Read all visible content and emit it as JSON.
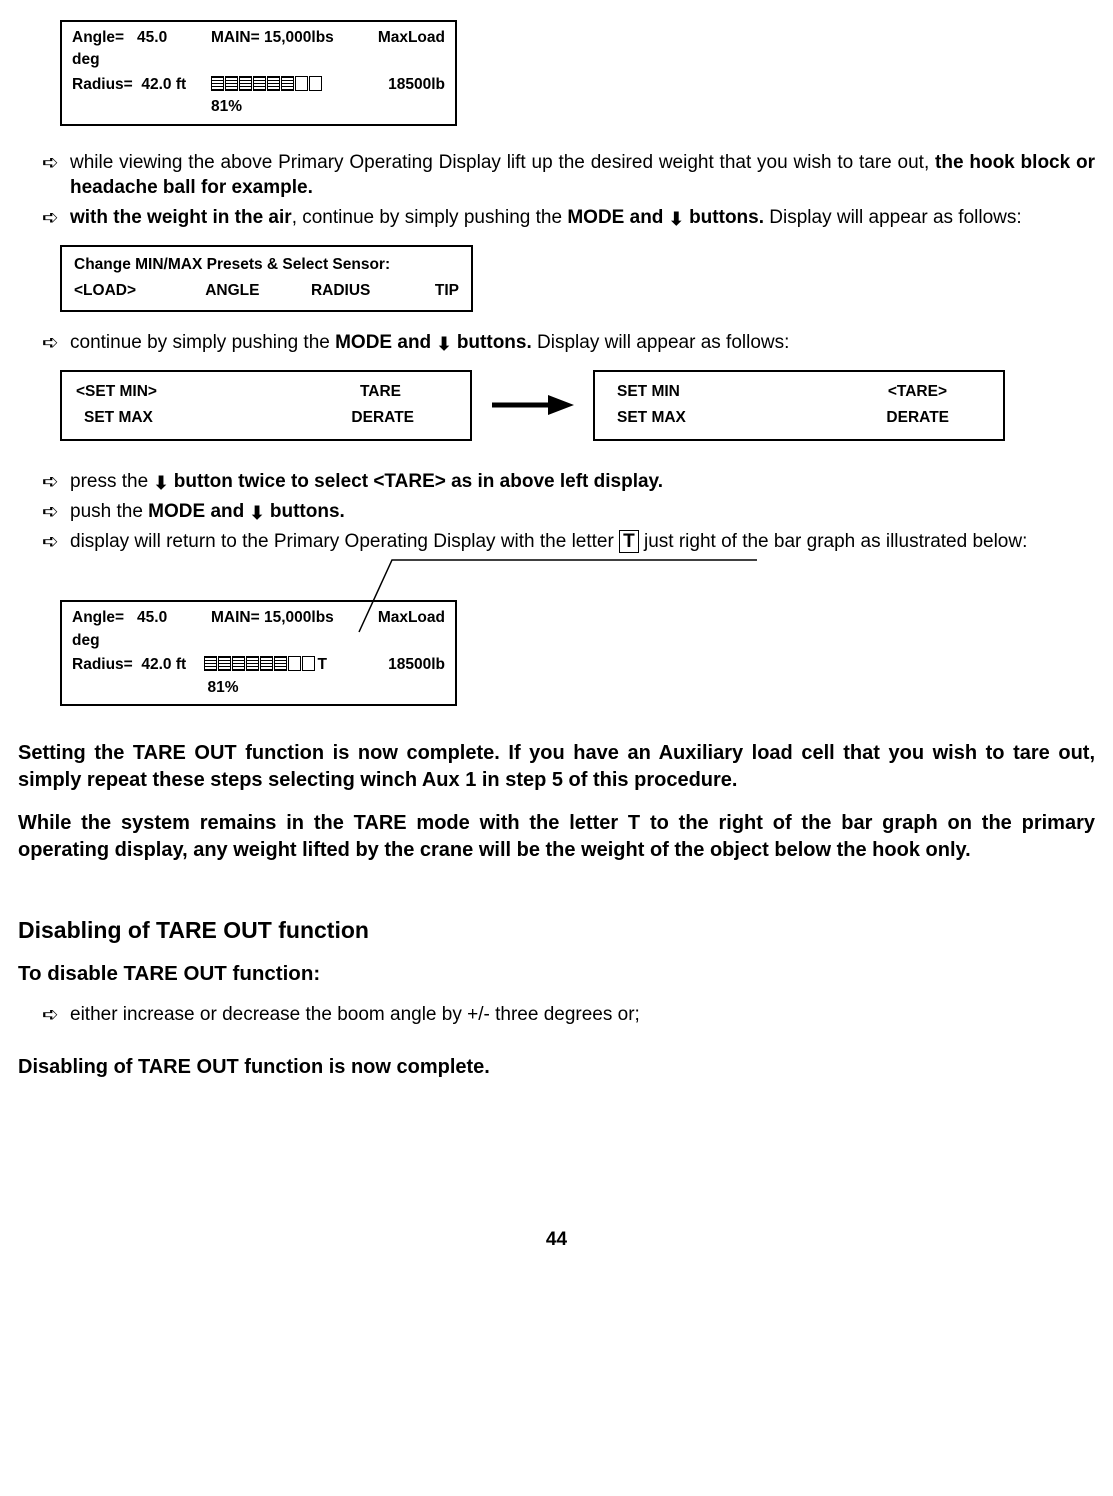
{
  "box1": {
    "angleLabel": "Angle=",
    "angleVal": "45.0 deg",
    "mainLabel": "MAIN=",
    "mainVal": "15,000lbs",
    "maxLoadLabel": "MaxLoad",
    "radiusLabel": "Radius=",
    "radiusVal": "42.0 ft",
    "percent": "81%",
    "maxLoadVal": "18500lb"
  },
  "step1": {
    "a": "while viewing the above Primary Operating Display lift up the desired weight that you wish to tare out, ",
    "b": "the hook block or headache ball for example.",
    "c_a": "with the weight in the air",
    "c_b": ", continue by simply pushing the ",
    "c_c": "MODE and ",
    "c_d": " buttons.",
    "c_e": "   Display will appear as follows:"
  },
  "box2": {
    "title": "Change  MIN/MAX  Presets  &  Select  Sensor:",
    "load": "<LOAD>",
    "angle": "ANGLE",
    "radius": "RADIUS",
    "tip": "TIP"
  },
  "step2": {
    "a": "continue by simply pushing the ",
    "b": "MODE and ",
    "c": " buttons.",
    "d": "  Display will appear as follows:"
  },
  "box3": {
    "setmin": "<SET MIN>",
    "tare": "TARE",
    "setmax": "SET MAX",
    "derate": "DERATE"
  },
  "box4": {
    "setmin": "SET MIN",
    "tare": "<TARE>",
    "setmax": "SET MAX",
    "derate": "DERATE"
  },
  "step3": {
    "a_a": "press the ",
    "a_b": " button twice to select <TARE> as in above left display.",
    "b_a": "push the ",
    "b_b": "MODE and ",
    "b_c": " buttons.",
    "c_a": "display will return to the Primary Operating Display with the letter  ",
    "c_letter": "T",
    "c_b": "  just right of the bar graph as illustrated below:"
  },
  "box5": {
    "angleLabel": "Angle=",
    "angleVal": "45.0 deg",
    "mainLabel": "MAIN=",
    "mainVal": "15,000lbs",
    "maxLoadLabel": "MaxLoad",
    "radiusLabel": "Radius=",
    "radiusVal": "42.0 ft",
    "tLetter": "T",
    "percent": "81%",
    "maxLoadVal": "18500lb"
  },
  "p1": "Setting the TARE OUT function is now complete.  If you have an Auxiliary load cell that you wish to tare out, simply repeat these steps selecting winch Aux 1 in step 5 of this procedure.",
  "p2": "While the system remains in the TARE mode with the letter T to the right of the bar graph on the primary operating display, any weight lifted by the crane will be the weight of the object below the hook only.",
  "h1": "Disabling of TARE OUT function",
  "h2": "To disable TARE OUT function:",
  "step4": "either increase or decrease the boom angle by +/-  three degrees or;",
  "p3": "Disabling of TARE OUT function is now complete.",
  "pageNum": "44"
}
